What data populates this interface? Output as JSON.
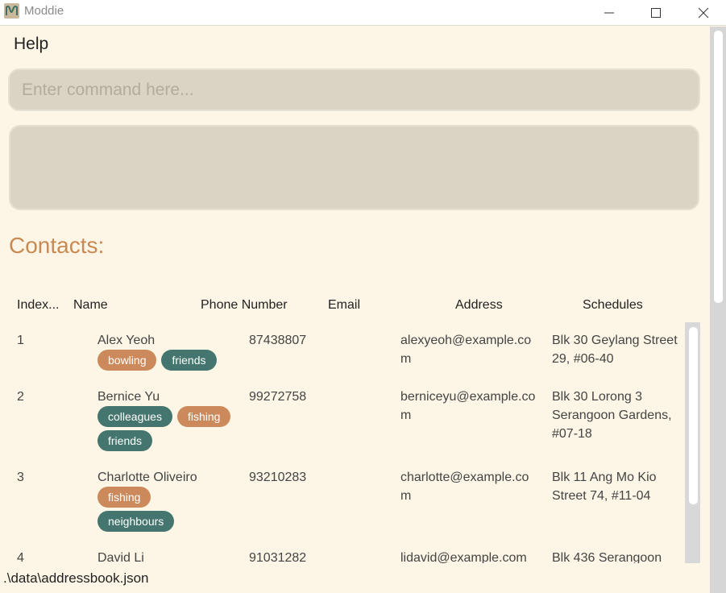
{
  "window": {
    "title": "Moddie"
  },
  "menu": {
    "help_label": "Help"
  },
  "command": {
    "placeholder": "Enter command here..."
  },
  "result": {
    "text": ""
  },
  "contacts_title": "Contacts:",
  "columns": [
    "Index...",
    "Name",
    "Phone Number",
    "Email",
    "Address",
    "Schedules"
  ],
  "contacts": [
    {
      "index": "1",
      "name": "Alex Yeoh",
      "phone": "87438807",
      "email": "alexyeoh@example.com",
      "address": "Blk 30 Geylang Street 29, #06-40",
      "tags": [
        {
          "label": "bowling",
          "color": "brown"
        },
        {
          "label": "friends",
          "color": "teal"
        }
      ]
    },
    {
      "index": "2",
      "name": "Bernice Yu",
      "phone": "99272758",
      "email": "berniceyu@example.com",
      "address": "Blk 30 Lorong 3 Serangoon Gardens, #07-18",
      "tags": [
        {
          "label": "colleagues",
          "color": "teal"
        },
        {
          "label": "fishing",
          "color": "brown"
        },
        {
          "label": "friends",
          "color": "teal"
        }
      ]
    },
    {
      "index": "3",
      "name": "Charlotte Oliveiro",
      "phone": "93210283",
      "email": "charlotte@example.com",
      "address": "Blk 11 Ang Mo Kio Street 74, #11-04",
      "tags": [
        {
          "label": "fishing",
          "color": "brown"
        },
        {
          "label": "neighbours",
          "color": "teal"
        }
      ]
    },
    {
      "index": "4",
      "name": "David Li",
      "phone": "91031282",
      "email": "lidavid@example.com",
      "address": "Blk 436 Serangoon",
      "tags": []
    }
  ],
  "status": {
    "file_path": ".\\data\\addressbook.json"
  },
  "colors": {
    "background": "#fdf6e6",
    "accent": "#c88a52",
    "tag_brown": "#cc8a5c",
    "tag_teal": "#44756e",
    "input_bg": "#dbd4c4"
  }
}
